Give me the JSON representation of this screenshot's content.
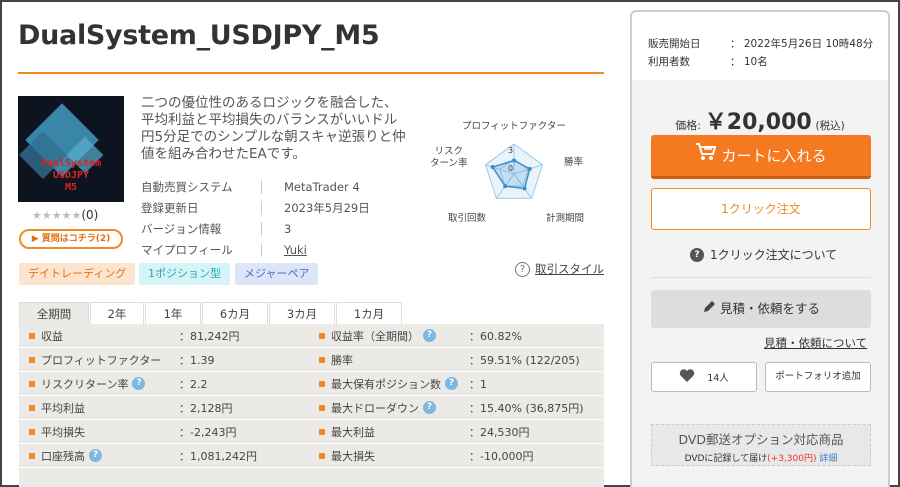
{
  "product": {
    "title": "DualSystem_USDJPY_M5",
    "thumbnail_text": "DualSystem\nUSDJPY\nM5",
    "rating_stars": "★★★★★",
    "rating_count": "(0)",
    "question_button": "▶ 質問はコチラ(2)",
    "description": "二つの優位性のあるロジックを融合した、平均利益と平均損失のバランスがいいドル円5分足でのシンプルな朝スキャ逆張りと仲値を組み合わせたEAです。"
  },
  "info": [
    {
      "key": "自動売買システム",
      "value": "MetaTrader 4"
    },
    {
      "key": "登録更新日",
      "value": "2023年5月29日"
    },
    {
      "key": "バージョン情報",
      "value": "3"
    },
    {
      "key": "マイプロフィール",
      "value": "Yuki"
    }
  ],
  "radar": {
    "labels": {
      "pf": "プロフィットファクター",
      "return_risk": "リスク\nターン率",
      "winrate": "勝率",
      "trades": "取引回数",
      "period": "計測期間"
    },
    "ticks": {
      "outer": "3",
      "inner": "0"
    },
    "values": {
      "pf": 0.45,
      "winrate": 0.55,
      "period": 0.6,
      "trades": 0.5,
      "return_risk": 0.75
    }
  },
  "tags": [
    "デイトレーディング",
    "1ポジション型",
    "メジャーペア"
  ],
  "style_link": "取引スタイル",
  "tabs": [
    "全期間",
    "2年",
    "1年",
    "6カ月",
    "3カ月",
    "1カ月"
  ],
  "stats": [
    {
      "l_label": "収益",
      "l_value": "：81,242円",
      "l_hint": false,
      "r_label": "収益率（全期間）",
      "r_value": "：60.82%",
      "r_hint": true
    },
    {
      "l_label": "プロフィットファクター",
      "l_value": "：1.39",
      "l_hint": false,
      "r_label": "勝率",
      "r_value": "：59.51% (122/205)",
      "r_hint": false
    },
    {
      "l_label": "リスクリターン率",
      "l_value": "：2.2",
      "l_hint": true,
      "r_label": "最大保有ポジション数",
      "r_value": "：1",
      "r_hint": true
    },
    {
      "l_label": "平均利益",
      "l_value": "：2,128円",
      "l_hint": false,
      "r_label": "最大ドローダウン",
      "r_value": "：15.40% (36,875円)",
      "r_hint": true
    },
    {
      "l_label": "平均損失",
      "l_value": "：-2,243円",
      "l_hint": false,
      "r_label": "最大利益",
      "r_value": "：24,530円",
      "r_hint": false
    },
    {
      "l_label": "口座残高",
      "l_value": "：1,081,242円",
      "l_hint": true,
      "r_label": "最大損失",
      "r_value": "：-10,000円",
      "r_hint": false
    }
  ],
  "sidebar": {
    "sale_start_label": "販売開始日",
    "sale_start_value": "：  2022年5月26日 10時48分",
    "users_label": "利用者数",
    "users_value": "：  10名",
    "price_label": "価格:",
    "price_amount": "￥20,000",
    "price_tax": "(税込)",
    "cart_button": "カートに入れる",
    "oneclick_button": "1クリック注文",
    "oneclick_about": "1クリック注文について",
    "quote_button": "見積・依頼をする",
    "quote_link": "見積・依頼について",
    "fav_count": "14人",
    "portfolio_button": "ポートフォリオ追加",
    "dvd_title": "DVD郵送オプション対応商品",
    "dvd_line_a": "DVDに記録して届け",
    "dvd_line_price": "(+3,300円)",
    "dvd_line_detail": "詳細"
  },
  "colors": {
    "accent": "#f08a24",
    "cart": "#f47920",
    "hint": "#7cb8e2"
  }
}
